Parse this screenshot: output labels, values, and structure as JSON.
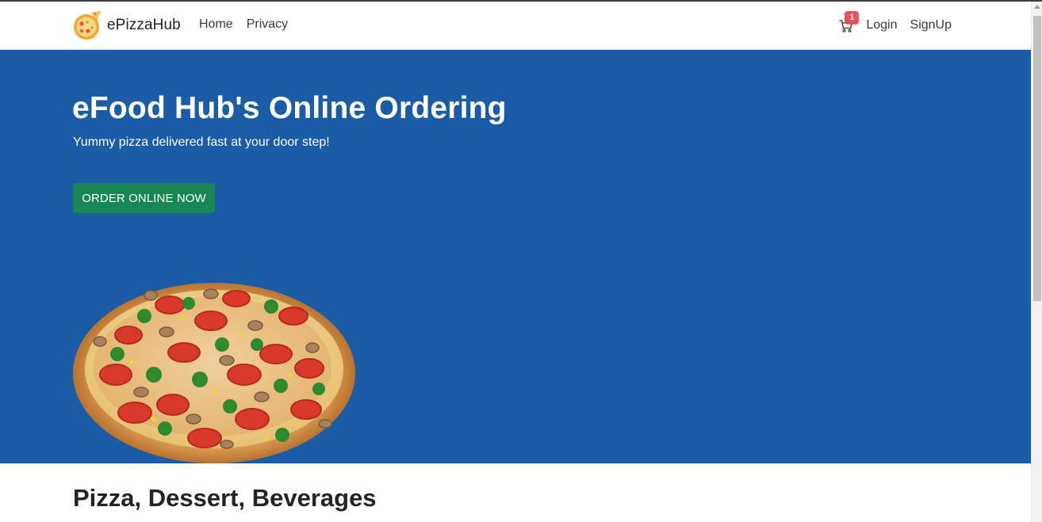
{
  "navbar": {
    "brand_name": "ePizzaHub",
    "logo_icon": "pizza-logo-icon",
    "links": [
      {
        "label": "Home"
      },
      {
        "label": "Privacy"
      }
    ],
    "cart": {
      "icon": "cart-icon",
      "count": "1"
    },
    "login_label": "Login",
    "signup_label": "SignUp"
  },
  "hero": {
    "title": "eFood Hub's Online Ordering",
    "subtitle": "Yummy pizza delivered fast at your door step!",
    "cta_label": "ORDER ONLINE NOW",
    "image": "pizza-image"
  },
  "section": {
    "title": "Pizza, Dessert, Beverages"
  },
  "colors": {
    "hero_bg": "#1a5ca6",
    "cta_bg": "#198754",
    "badge_bg": "#e8505b"
  }
}
